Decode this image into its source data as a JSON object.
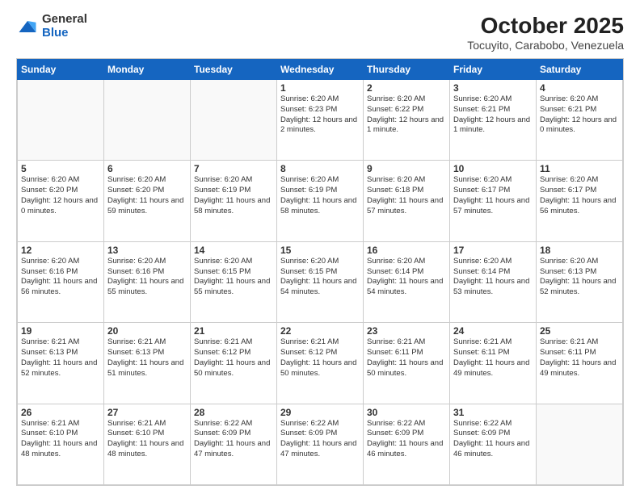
{
  "header": {
    "logo": {
      "line1": "General",
      "line2": "Blue"
    },
    "title": "October 2025",
    "subtitle": "Tocuyito, Carabobo, Venezuela"
  },
  "weekdays": [
    "Sunday",
    "Monday",
    "Tuesday",
    "Wednesday",
    "Thursday",
    "Friday",
    "Saturday"
  ],
  "weeks": [
    [
      {
        "day": "",
        "sunrise": "",
        "sunset": "",
        "daylight": ""
      },
      {
        "day": "",
        "sunrise": "",
        "sunset": "",
        "daylight": ""
      },
      {
        "day": "",
        "sunrise": "",
        "sunset": "",
        "daylight": ""
      },
      {
        "day": "1",
        "sunrise": "Sunrise: 6:20 AM",
        "sunset": "Sunset: 6:23 PM",
        "daylight": "Daylight: 12 hours and 2 minutes."
      },
      {
        "day": "2",
        "sunrise": "Sunrise: 6:20 AM",
        "sunset": "Sunset: 6:22 PM",
        "daylight": "Daylight: 12 hours and 1 minute."
      },
      {
        "day": "3",
        "sunrise": "Sunrise: 6:20 AM",
        "sunset": "Sunset: 6:21 PM",
        "daylight": "Daylight: 12 hours and 1 minute."
      },
      {
        "day": "4",
        "sunrise": "Sunrise: 6:20 AM",
        "sunset": "Sunset: 6:21 PM",
        "daylight": "Daylight: 12 hours and 0 minutes."
      }
    ],
    [
      {
        "day": "5",
        "sunrise": "Sunrise: 6:20 AM",
        "sunset": "Sunset: 6:20 PM",
        "daylight": "Daylight: 12 hours and 0 minutes."
      },
      {
        "day": "6",
        "sunrise": "Sunrise: 6:20 AM",
        "sunset": "Sunset: 6:20 PM",
        "daylight": "Daylight: 11 hours and 59 minutes."
      },
      {
        "day": "7",
        "sunrise": "Sunrise: 6:20 AM",
        "sunset": "Sunset: 6:19 PM",
        "daylight": "Daylight: 11 hours and 58 minutes."
      },
      {
        "day": "8",
        "sunrise": "Sunrise: 6:20 AM",
        "sunset": "Sunset: 6:19 PM",
        "daylight": "Daylight: 11 hours and 58 minutes."
      },
      {
        "day": "9",
        "sunrise": "Sunrise: 6:20 AM",
        "sunset": "Sunset: 6:18 PM",
        "daylight": "Daylight: 11 hours and 57 minutes."
      },
      {
        "day": "10",
        "sunrise": "Sunrise: 6:20 AM",
        "sunset": "Sunset: 6:17 PM",
        "daylight": "Daylight: 11 hours and 57 minutes."
      },
      {
        "day": "11",
        "sunrise": "Sunrise: 6:20 AM",
        "sunset": "Sunset: 6:17 PM",
        "daylight": "Daylight: 11 hours and 56 minutes."
      }
    ],
    [
      {
        "day": "12",
        "sunrise": "Sunrise: 6:20 AM",
        "sunset": "Sunset: 6:16 PM",
        "daylight": "Daylight: 11 hours and 56 minutes."
      },
      {
        "day": "13",
        "sunrise": "Sunrise: 6:20 AM",
        "sunset": "Sunset: 6:16 PM",
        "daylight": "Daylight: 11 hours and 55 minutes."
      },
      {
        "day": "14",
        "sunrise": "Sunrise: 6:20 AM",
        "sunset": "Sunset: 6:15 PM",
        "daylight": "Daylight: 11 hours and 55 minutes."
      },
      {
        "day": "15",
        "sunrise": "Sunrise: 6:20 AM",
        "sunset": "Sunset: 6:15 PM",
        "daylight": "Daylight: 11 hours and 54 minutes."
      },
      {
        "day": "16",
        "sunrise": "Sunrise: 6:20 AM",
        "sunset": "Sunset: 6:14 PM",
        "daylight": "Daylight: 11 hours and 54 minutes."
      },
      {
        "day": "17",
        "sunrise": "Sunrise: 6:20 AM",
        "sunset": "Sunset: 6:14 PM",
        "daylight": "Daylight: 11 hours and 53 minutes."
      },
      {
        "day": "18",
        "sunrise": "Sunrise: 6:20 AM",
        "sunset": "Sunset: 6:13 PM",
        "daylight": "Daylight: 11 hours and 52 minutes."
      }
    ],
    [
      {
        "day": "19",
        "sunrise": "Sunrise: 6:21 AM",
        "sunset": "Sunset: 6:13 PM",
        "daylight": "Daylight: 11 hours and 52 minutes."
      },
      {
        "day": "20",
        "sunrise": "Sunrise: 6:21 AM",
        "sunset": "Sunset: 6:13 PM",
        "daylight": "Daylight: 11 hours and 51 minutes."
      },
      {
        "day": "21",
        "sunrise": "Sunrise: 6:21 AM",
        "sunset": "Sunset: 6:12 PM",
        "daylight": "Daylight: 11 hours and 50 minutes."
      },
      {
        "day": "22",
        "sunrise": "Sunrise: 6:21 AM",
        "sunset": "Sunset: 6:12 PM",
        "daylight": "Daylight: 11 hours and 50 minutes."
      },
      {
        "day": "23",
        "sunrise": "Sunrise: 6:21 AM",
        "sunset": "Sunset: 6:11 PM",
        "daylight": "Daylight: 11 hours and 50 minutes."
      },
      {
        "day": "24",
        "sunrise": "Sunrise: 6:21 AM",
        "sunset": "Sunset: 6:11 PM",
        "daylight": "Daylight: 11 hours and 49 minutes."
      },
      {
        "day": "25",
        "sunrise": "Sunrise: 6:21 AM",
        "sunset": "Sunset: 6:11 PM",
        "daylight": "Daylight: 11 hours and 49 minutes."
      }
    ],
    [
      {
        "day": "26",
        "sunrise": "Sunrise: 6:21 AM",
        "sunset": "Sunset: 6:10 PM",
        "daylight": "Daylight: 11 hours and 48 minutes."
      },
      {
        "day": "27",
        "sunrise": "Sunrise: 6:21 AM",
        "sunset": "Sunset: 6:10 PM",
        "daylight": "Daylight: 11 hours and 48 minutes."
      },
      {
        "day": "28",
        "sunrise": "Sunrise: 6:22 AM",
        "sunset": "Sunset: 6:09 PM",
        "daylight": "Daylight: 11 hours and 47 minutes."
      },
      {
        "day": "29",
        "sunrise": "Sunrise: 6:22 AM",
        "sunset": "Sunset: 6:09 PM",
        "daylight": "Daylight: 11 hours and 47 minutes."
      },
      {
        "day": "30",
        "sunrise": "Sunrise: 6:22 AM",
        "sunset": "Sunset: 6:09 PM",
        "daylight": "Daylight: 11 hours and 46 minutes."
      },
      {
        "day": "31",
        "sunrise": "Sunrise: 6:22 AM",
        "sunset": "Sunset: 6:09 PM",
        "daylight": "Daylight: 11 hours and 46 minutes."
      },
      {
        "day": "",
        "sunrise": "",
        "sunset": "",
        "daylight": ""
      }
    ]
  ]
}
